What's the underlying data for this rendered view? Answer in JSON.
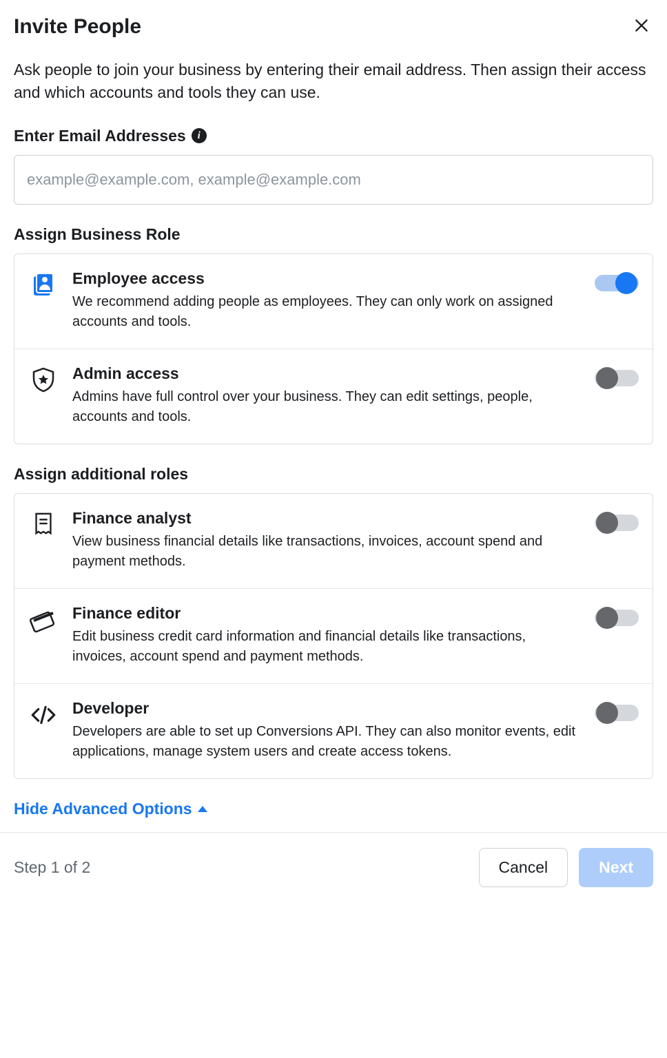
{
  "modal": {
    "title": "Invite People",
    "description": "Ask people to join your business by entering their email address. Then assign their access and which accounts and tools they can use."
  },
  "email": {
    "label": "Enter Email Addresses",
    "placeholder": "example@example.com, example@example.com",
    "value": ""
  },
  "business_role": {
    "label": "Assign Business Role",
    "items": [
      {
        "title": "Employee access",
        "desc": "We recommend adding people as employees. They can only work on assigned accounts and tools.",
        "enabled": true
      },
      {
        "title": "Admin access",
        "desc": "Admins have full control over your business. They can edit settings, people, accounts and tools.",
        "enabled": false
      }
    ]
  },
  "additional_roles": {
    "label": "Assign additional roles",
    "items": [
      {
        "title": "Finance analyst",
        "desc": "View business financial details like transactions, invoices, account spend and payment methods.",
        "enabled": false
      },
      {
        "title": "Finance editor",
        "desc": "Edit business credit card information and financial details like transactions, invoices, account spend and payment methods.",
        "enabled": false
      },
      {
        "title": "Developer",
        "desc": "Developers are able to set up Conversions API. They can also monitor events, edit applications, manage system users and create access tokens.",
        "enabled": false
      }
    ]
  },
  "advanced_link": "Hide Advanced Options",
  "footer": {
    "step": "Step 1 of 2",
    "cancel": "Cancel",
    "next": "Next"
  }
}
